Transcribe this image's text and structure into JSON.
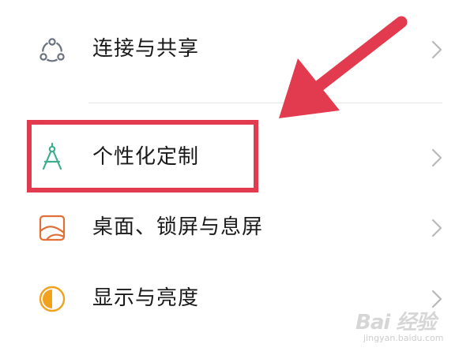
{
  "settings_list": {
    "items": [
      {
        "label": "连接与共享",
        "icon": "share-nodes-icon",
        "icon_color": "#6b7280"
      },
      {
        "label": "个性化定制",
        "icon": "compass-icon",
        "icon_color": "#3fae8c"
      },
      {
        "label": "桌面、锁屏与息屏",
        "icon": "wallpaper-icon",
        "icon_color": "#e0703a"
      },
      {
        "label": "显示与亮度",
        "icon": "brightness-icon",
        "icon_color": "#f0a21c"
      }
    ]
  },
  "annotation": {
    "highlight_color": "#e23a4e",
    "arrow_color": "#e23a4e"
  },
  "watermark": {
    "logo_text": "Bai 经验",
    "sub_text": "jingyan.baidu.com"
  }
}
